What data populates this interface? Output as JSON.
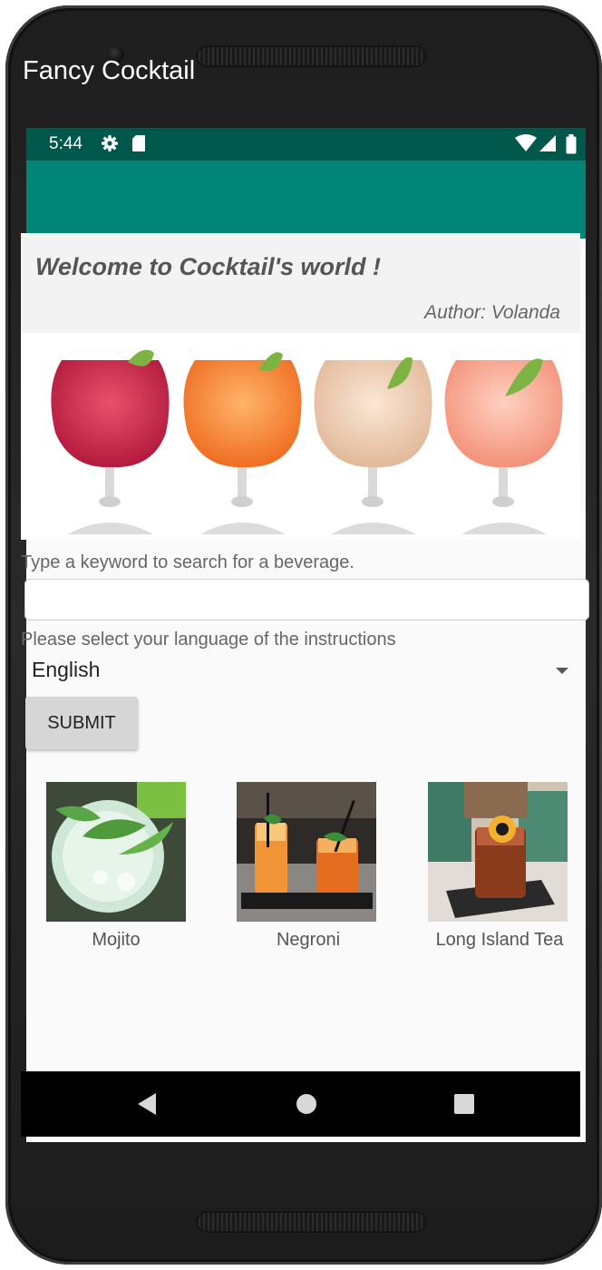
{
  "status_bar": {
    "time": "5:44",
    "icons": [
      "settings-gear-icon",
      "sd-card-icon",
      "wifi-icon",
      "cell-signal-icon",
      "battery-icon"
    ]
  },
  "app_bar": {
    "title": "Fancy Cocktail"
  },
  "welcome": {
    "title": "Welcome to Cocktail's world !",
    "author": "Author: Volanda"
  },
  "hero_image": {
    "subject": "four cocktail glasses with lime wedges"
  },
  "search": {
    "label": "Type a keyword to search for a beverage.",
    "value": "",
    "placeholder": ""
  },
  "language": {
    "label": "Please select your language of the instructions",
    "selected": "English"
  },
  "submit_label": "SUBMIT",
  "drinks": [
    {
      "name": "Mojito"
    },
    {
      "name": "Negroni"
    },
    {
      "name": "Long Island Tea"
    }
  ],
  "colors": {
    "status_bar": "#00574b",
    "app_bar": "#008577",
    "background": "#fafafa",
    "button": "#d6d6d6"
  },
  "nav_bar": {
    "icons": [
      "back-icon",
      "home-icon",
      "recents-icon"
    ]
  }
}
